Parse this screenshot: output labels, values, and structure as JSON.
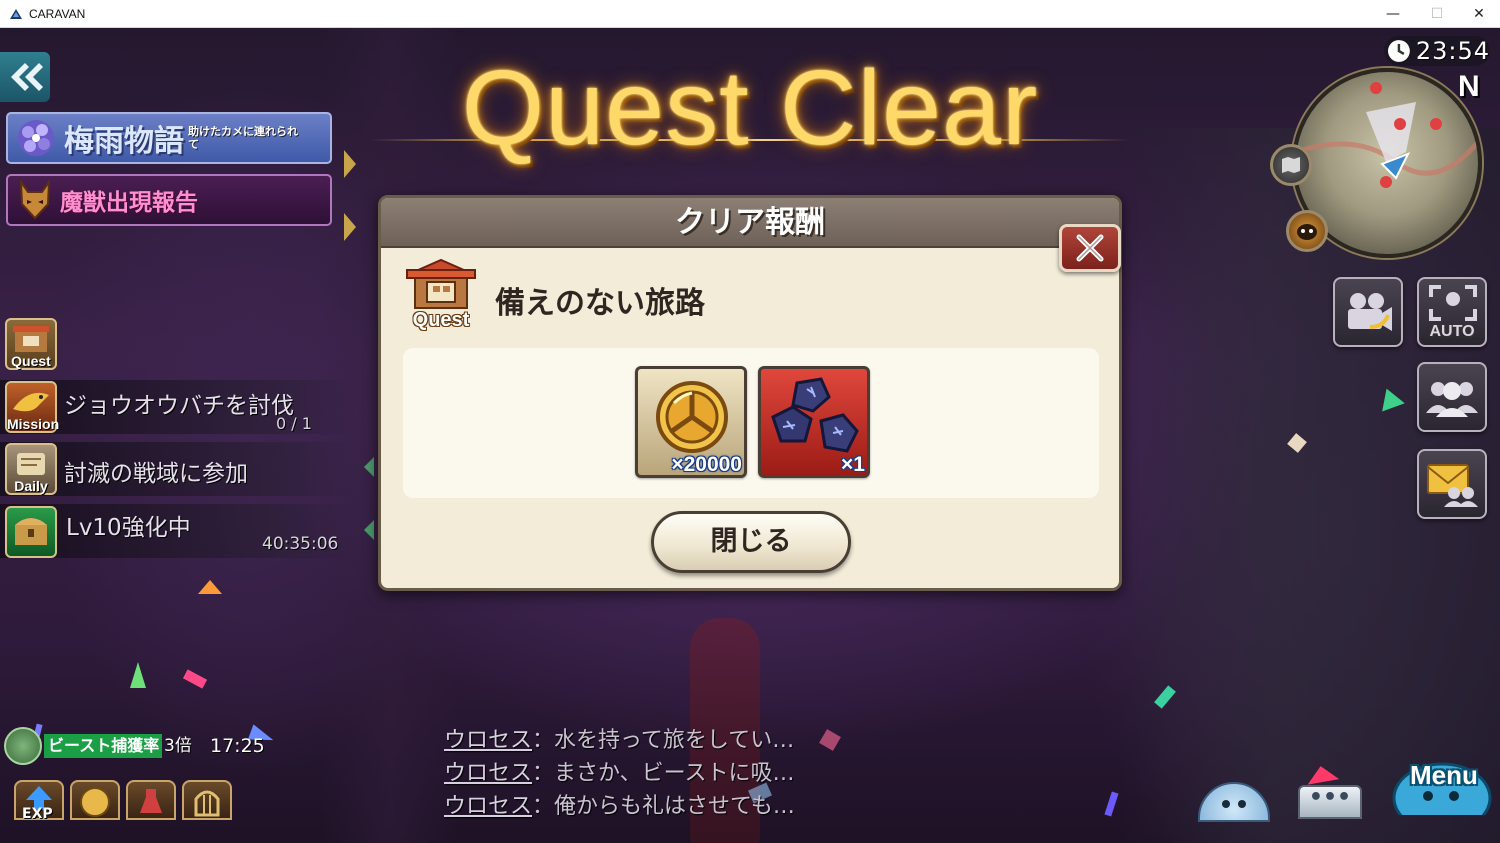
{
  "window": {
    "title": "CARAVAN",
    "controls": {
      "minimize": "—",
      "maximize": "☐",
      "close": "✕"
    }
  },
  "hud": {
    "clock": "23:54",
    "compass": "N",
    "auto_label": "AUTO",
    "menu_label": "Menu",
    "chat_button": "•••"
  },
  "banners": {
    "event_title": "梅雨物語",
    "event_subtitle": "助けたカメに連れられて",
    "beast_report": "魔獣出現報告"
  },
  "quests": [
    {
      "icon_label": "Quest",
      "text": "",
      "sub": ""
    },
    {
      "icon_label": "Mission",
      "text": "ジョウオウバチを討伐",
      "sub": "0 / 1"
    },
    {
      "icon_label": "Daily",
      "text": "討滅の戦域に参加",
      "sub": ""
    },
    {
      "icon_label": "",
      "text": "Lv10強化中",
      "sub": "40:35:06"
    }
  ],
  "beast_capture": {
    "label": "ビースト捕獲率",
    "multiplier": "3倍",
    "time": "17:25"
  },
  "boost_icons": [
    "EXP",
    "",
    "",
    ""
  ],
  "boost_labels": {
    "exp": "EXP"
  },
  "chat": [
    {
      "name": "ウロセス",
      "message": "：水を持って旅をしてい…"
    },
    {
      "name": "ウロセス",
      "message": "：まさか、ビーストに吸…"
    },
    {
      "name": "ウロセス",
      "message": "：俺からも礼はさせても…"
    }
  ],
  "quest_clear": {
    "title": "Quest Clear"
  },
  "dialog": {
    "title": "クリア報酬",
    "quest_badge": "Quest",
    "quest_name": "備えのない旅路",
    "rewards": [
      {
        "icon": "gold-coin-icon",
        "quantity": "×20000"
      },
      {
        "icon": "ore-stones-icon",
        "quantity": "×1"
      }
    ],
    "close_button": "閉じる"
  },
  "colors": {
    "title_gold": "#ffd86a",
    "dialog_bg": "#f2ecd8",
    "dialog_header": "#7c6f65",
    "close_x_red": "#9c3028",
    "beast_green": "#1a9f44"
  }
}
